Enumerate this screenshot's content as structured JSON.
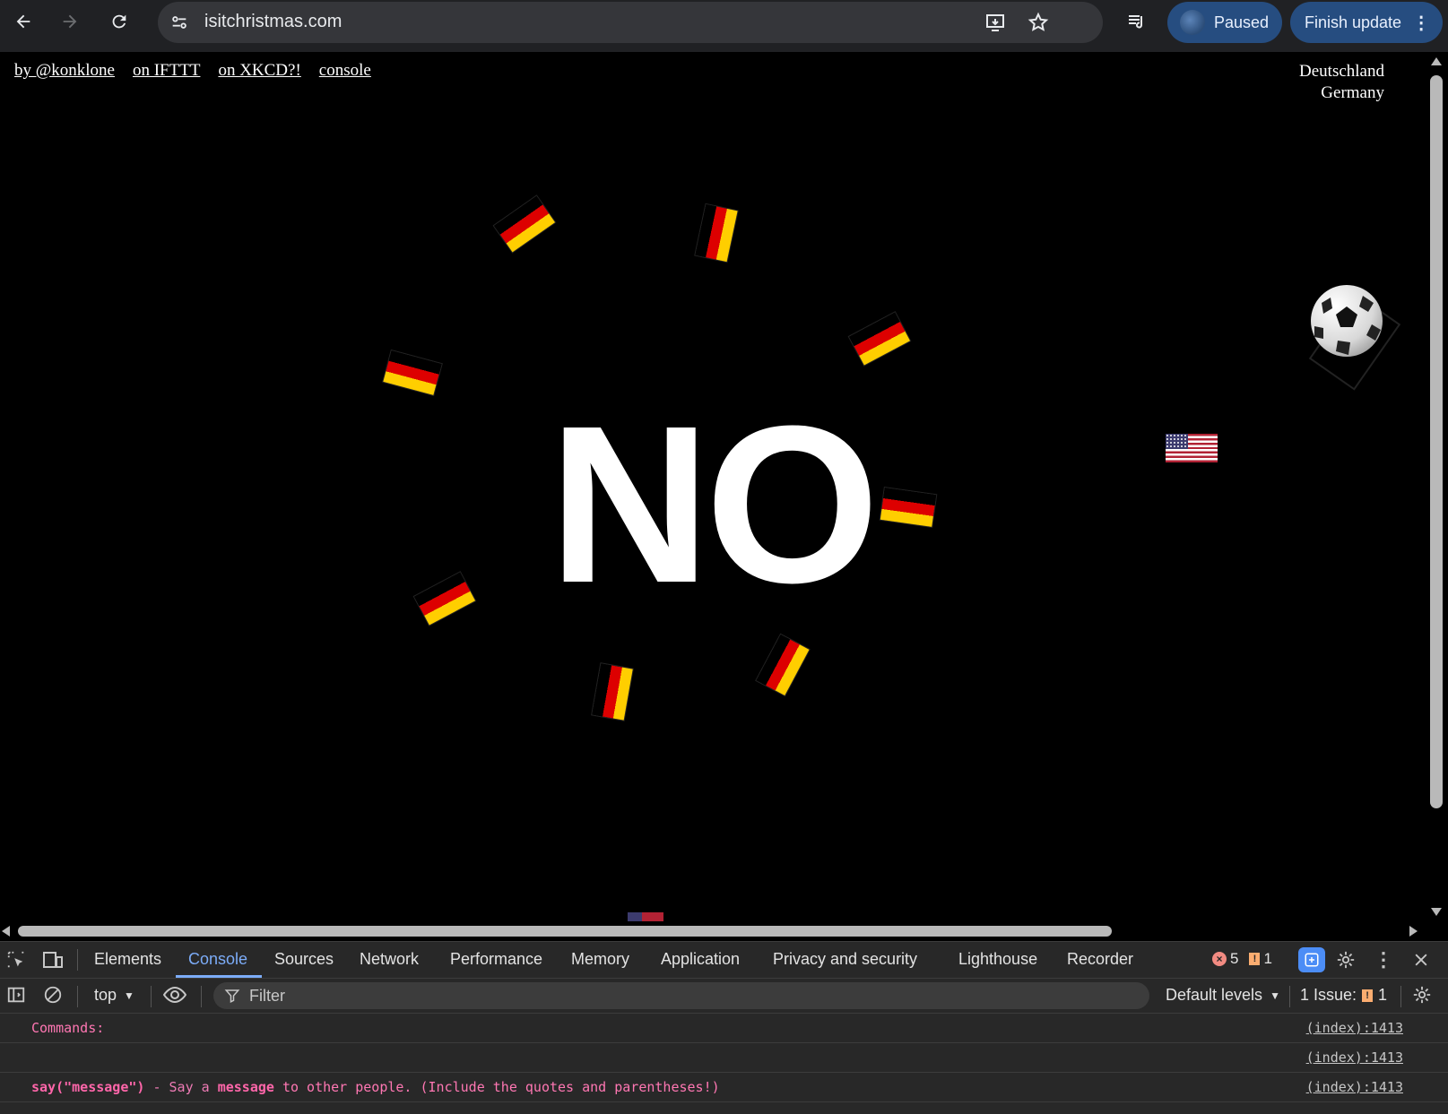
{
  "browser": {
    "url": "isitchristmas.com",
    "profile_label": "Paused",
    "update_label": "Finish update"
  },
  "page": {
    "links": [
      "by @konklone",
      "on IFTTT",
      "on XKCD?!",
      "console"
    ],
    "country_native": "Deutschland",
    "country_english": "Germany",
    "answer": "NO"
  },
  "devtools": {
    "tabs": [
      "Elements",
      "Console",
      "Sources",
      "Network",
      "Performance",
      "Memory",
      "Application",
      "Privacy and security",
      "Lighthouse",
      "Recorder"
    ],
    "active_tab": "Console",
    "error_count": "5",
    "warning_count": "1",
    "context": "top",
    "filter_placeholder": "Filter",
    "levels": "Default levels",
    "issues_label": "1 Issue:",
    "issues_count": "1",
    "console_lines": [
      {
        "text": "Commands:",
        "source": "(index):1413"
      },
      {
        "text": "",
        "source": "(index):1413"
      },
      {
        "cmd": "say(\"message\")",
        "sep": " - Say a ",
        "bold": "message",
        "rest": " to other people. (Include the quotes and parentheses!)",
        "source": "(index):1413"
      }
    ]
  }
}
